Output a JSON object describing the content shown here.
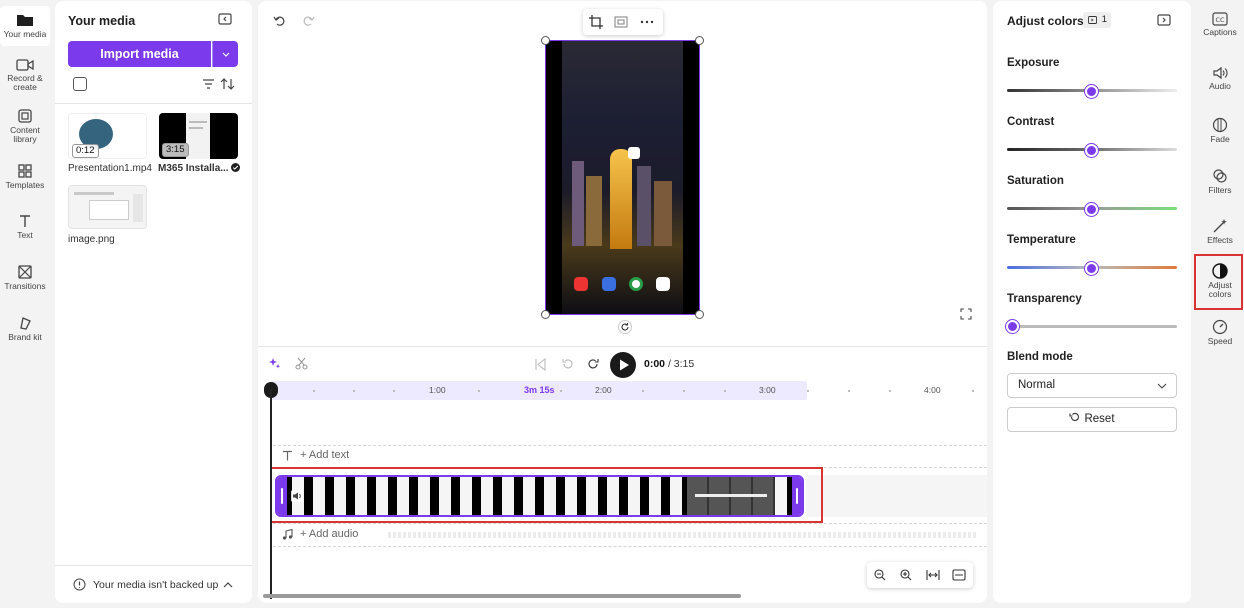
{
  "left_nav": [
    {
      "label": "Your media",
      "icon": "folder-icon"
    },
    {
      "label": "Record & create",
      "icon": "camera-icon"
    },
    {
      "label": "Content library",
      "icon": "library-icon"
    },
    {
      "label": "Templates",
      "icon": "templates-icon"
    },
    {
      "label": "Text",
      "icon": "text-icon"
    },
    {
      "label": "Transitions",
      "icon": "transitions-icon"
    },
    {
      "label": "Brand kit",
      "icon": "brand-kit-icon"
    }
  ],
  "media": {
    "title": "Your media",
    "import_label": "Import media",
    "items": [
      {
        "name": "Presentation1.mp4",
        "duration": "0:12"
      },
      {
        "name": "M365 Installa...",
        "duration": "3:15"
      },
      {
        "name": "image.png",
        "duration": ""
      }
    ],
    "backup_text": "Your media isn't backed up"
  },
  "player": {
    "current_time": "0:00",
    "total_time": "/ 3:15"
  },
  "timeline": {
    "ticks": [
      "1:00",
      "3m 15s",
      "2:00",
      "3:00",
      "4:00"
    ],
    "add_text": "+ Add text",
    "add_audio": "+ Add audio"
  },
  "adjust": {
    "title": "Adjust colors",
    "badge": "1",
    "sliders": [
      {
        "label": "Exposure",
        "value": 0.5
      },
      {
        "label": "Contrast",
        "value": 0.5
      },
      {
        "label": "Saturation",
        "value": 0.5
      },
      {
        "label": "Temperature",
        "value": 0.5
      },
      {
        "label": "Transparency",
        "value": 0.0
      }
    ],
    "blend_label": "Blend mode",
    "blend_value": "Normal",
    "reset_label": "Reset"
  },
  "right_nav": [
    {
      "label": "Captions",
      "icon": "captions-icon"
    },
    {
      "label": "Audio",
      "icon": "audio-icon"
    },
    {
      "label": "Fade",
      "icon": "fade-icon"
    },
    {
      "label": "Filters",
      "icon": "filters-icon"
    },
    {
      "label": "Effects",
      "icon": "effects-icon"
    },
    {
      "label": "Adjust colors",
      "icon": "adjust-colors-icon"
    },
    {
      "label": "Speed",
      "icon": "speed-icon"
    }
  ],
  "colors": {
    "accent": "#7c3aed",
    "highlight": "#d93434"
  }
}
